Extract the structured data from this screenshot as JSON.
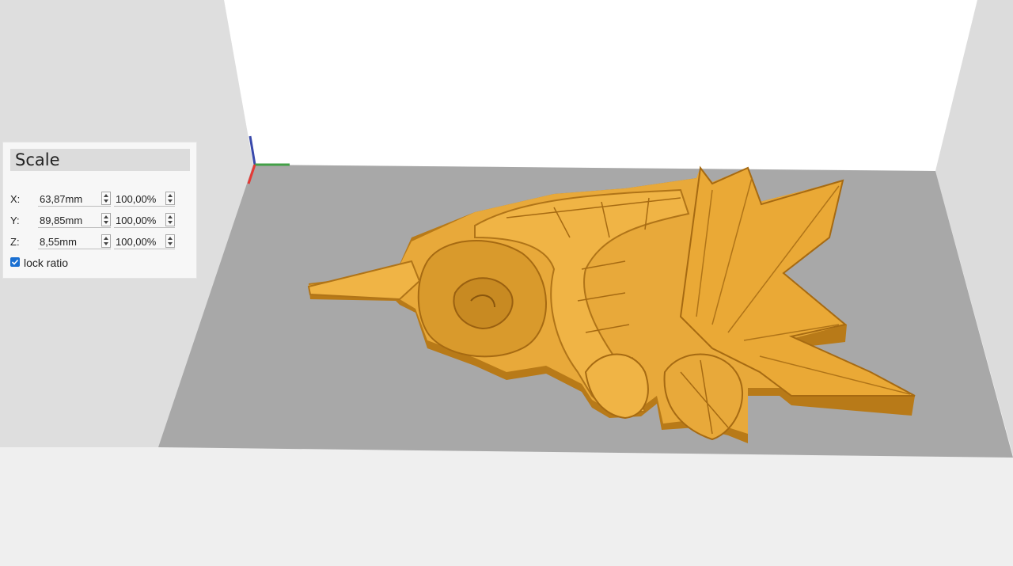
{
  "colors": {
    "background": "#efefef",
    "build_plate": "#a8a8a8",
    "model": "#e8a93a",
    "axis_x": "#e53935",
    "axis_y": "#43a047",
    "axis_z": "#3949ab",
    "checkbox": "#1a6fd1"
  },
  "scale_panel": {
    "title": "Scale",
    "rows": [
      {
        "label": "X:",
        "mm": "63,87mm",
        "percent": "100,00%"
      },
      {
        "label": "Y:",
        "mm": "89,85mm",
        "percent": "100,00%"
      },
      {
        "label": "Z:",
        "mm": "8,55mm",
        "percent": "100,00%"
      }
    ],
    "lock_ratio": {
      "label": "lock ratio",
      "checked": true
    }
  },
  "viewport": {
    "model": "dragon-relief-model",
    "axes_icon": "xyz-axis-gizmo"
  }
}
